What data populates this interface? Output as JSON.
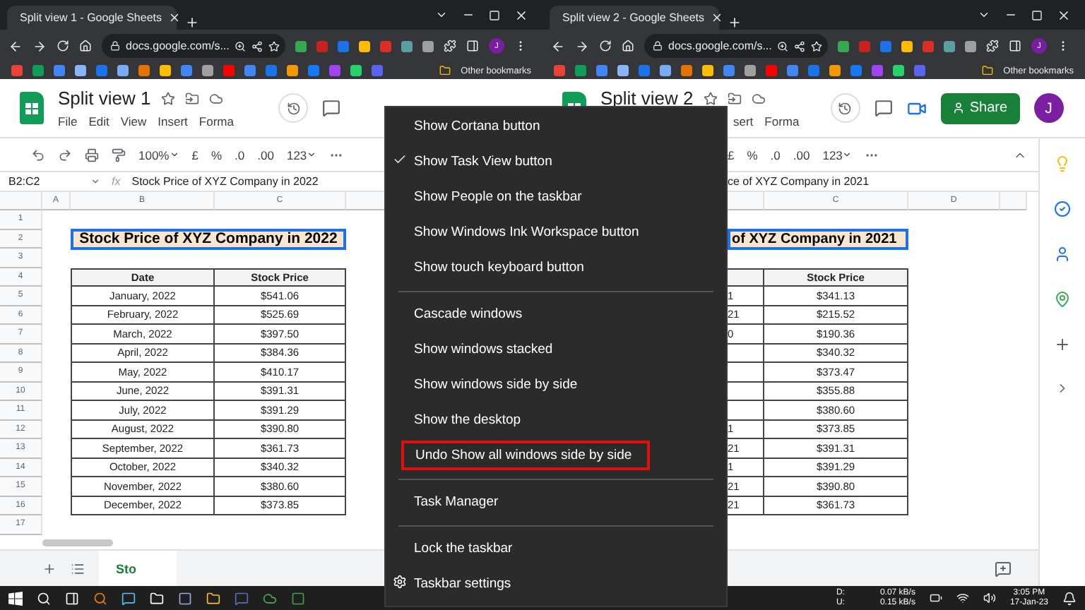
{
  "windows": [
    {
      "tab_title": "Split view 1 - Google Sheets",
      "url": "docs.google.com/s...",
      "avatar": "J",
      "bookmarks_label": "Other bookmarks",
      "doc_title": "Split view 1",
      "menus": [
        "File",
        "Edit",
        "View",
        "Insert",
        "Forma"
      ],
      "toolbar": {
        "zoom": "100%",
        "currency": "£",
        "percent": "%",
        "dec_less": ".0",
        "dec_more": ".00",
        "format": "123"
      },
      "name_box": "B2:C2",
      "fx_label": "fx",
      "formula": "Stock Price of XYZ Company in 2022",
      "columns": [
        "A",
        "B",
        "C"
      ],
      "row_numbers": [
        "1",
        "2",
        "3",
        "4",
        "5",
        "6",
        "7",
        "8",
        "9",
        "10",
        "11",
        "12",
        "13",
        "14",
        "15",
        "16",
        "17"
      ],
      "title": "Stock Price of XYZ Company in 2022",
      "table_header": [
        "Date",
        "Stock Price"
      ],
      "table_rows": [
        {
          "date": "January, 2022",
          "price": "$541.06"
        },
        {
          "date": "February, 2022",
          "price": "$525.69"
        },
        {
          "date": "March, 2022",
          "price": "$397.50"
        },
        {
          "date": "April, 2022",
          "price": "$384.36"
        },
        {
          "date": "May, 2022",
          "price": "$410.17"
        },
        {
          "date": "June, 2022",
          "price": "$391.31"
        },
        {
          "date": "July, 2022",
          "price": "$391.29"
        },
        {
          "date": "August, 2022",
          "price": "$390.80"
        },
        {
          "date": "September, 2022",
          "price": "$361.73"
        },
        {
          "date": "October, 2022",
          "price": "$340.32"
        },
        {
          "date": "November, 2022",
          "price": "$380.60"
        },
        {
          "date": "December, 2022",
          "price": "$373.85"
        }
      ],
      "sheet_tab": "Sto"
    },
    {
      "tab_title": "Split view 2 - Google Sheets",
      "url": "docs.google.com/s...",
      "avatar": "J",
      "bookmarks_label": "Other bookmarks",
      "doc_title": "Split view 2",
      "menus": [
        "sert",
        "Forma"
      ],
      "share": "Share",
      "header_avatar": "J",
      "toolbar": {
        "currency": "£",
        "percent": "%",
        "dec_less": ".0",
        "dec_more": ".00",
        "format": "123"
      },
      "formula": "ce of XYZ Company in 2021",
      "columns": [
        "C",
        "D"
      ],
      "title": "of XYZ Company in 2021",
      "table_header": [
        "Stock Price"
      ],
      "table_rows": [
        {
          "date": "1",
          "price": "$341.13"
        },
        {
          "date": "21",
          "price": "$215.52"
        },
        {
          "date": "0",
          "price": "$190.36"
        },
        {
          "price": "$340.32"
        },
        {
          "price": "$373.47"
        },
        {
          "price": "$355.88"
        },
        {
          "price": "$380.60"
        },
        {
          "date": "1",
          "price": "$373.85"
        },
        {
          "date": "21",
          "price": "$391.31"
        },
        {
          "date": "1",
          "price": "$391.29"
        },
        {
          "date": "21",
          "price": "$390.80"
        },
        {
          "date": "21",
          "price": "$361.73"
        }
      ]
    }
  ],
  "context_menu": [
    {
      "kind": "item",
      "label": "Show Cortana button",
      "checked": false,
      "highlighted": false
    },
    {
      "kind": "item",
      "label": "Show Task View button",
      "checked": true,
      "highlighted": false
    },
    {
      "kind": "item",
      "label": "Show People on the taskbar",
      "checked": false,
      "highlighted": false
    },
    {
      "kind": "item",
      "label": "Show Windows Ink Workspace button",
      "checked": false,
      "highlighted": false
    },
    {
      "kind": "item",
      "label": "Show touch keyboard button",
      "checked": false,
      "highlighted": false
    },
    {
      "kind": "separator"
    },
    {
      "kind": "item",
      "label": "Cascade windows",
      "checked": false,
      "highlighted": false
    },
    {
      "kind": "item",
      "label": "Show windows stacked",
      "checked": false,
      "highlighted": false
    },
    {
      "kind": "item",
      "label": "Show windows side by side",
      "checked": false,
      "highlighted": false
    },
    {
      "kind": "item",
      "label": "Show the desktop",
      "checked": false,
      "highlighted": false
    },
    {
      "kind": "item",
      "label": "Undo Show all windows side by side",
      "checked": false,
      "highlighted": true
    },
    {
      "kind": "separator"
    },
    {
      "kind": "item",
      "label": "Task Manager",
      "checked": false,
      "highlighted": false
    },
    {
      "kind": "separator"
    },
    {
      "kind": "item",
      "label": "Lock the taskbar",
      "checked": false,
      "highlighted": false
    },
    {
      "kind": "settings",
      "label": "Taskbar settings",
      "checked": false,
      "highlighted": false
    }
  ],
  "taskbar": {
    "net_labels": [
      "D:",
      "U:"
    ],
    "net_rates": [
      "0.07 kB/s",
      "0.15 kB/s"
    ],
    "time": "3:05 PM",
    "date": "17-Jan-23"
  }
}
